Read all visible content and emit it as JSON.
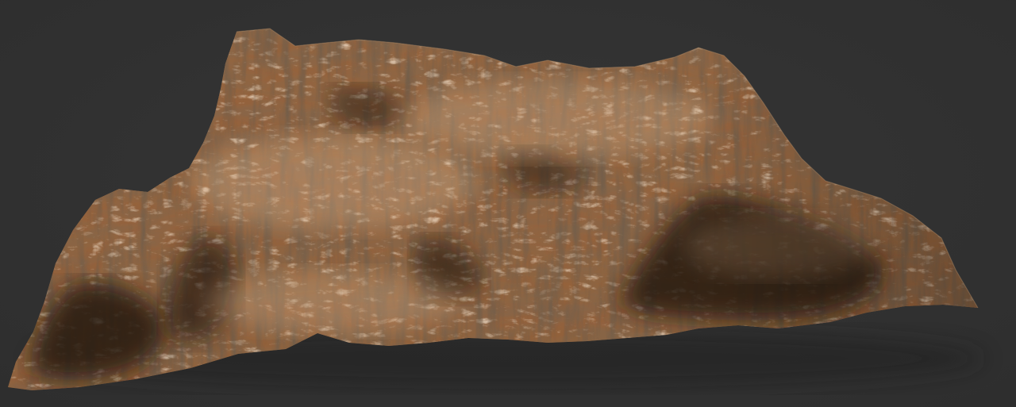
{
  "scene": {
    "subject": "terrain-mesh",
    "colors": {
      "background": "#323232",
      "rock_light": "#c8a27c",
      "rock_mid": "#8a6647",
      "rock_dark": "#4a3424",
      "rock_shadow": "#23180f"
    }
  }
}
